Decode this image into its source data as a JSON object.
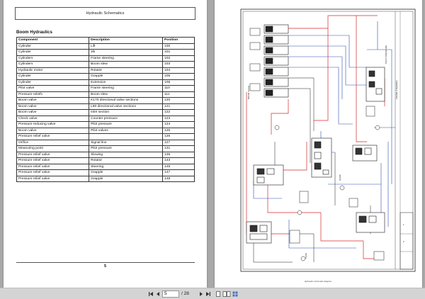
{
  "left_page": {
    "header": "Hydraulic Schematics",
    "section_title": "Boom Hydraulics",
    "table": {
      "headers": [
        "Component",
        "Description",
        "Position"
      ],
      "rows": [
        [
          "Cylinder",
          "Lift",
          "100"
        ],
        [
          "Cylinder",
          "Jib",
          "101"
        ],
        [
          "Cylinders",
          "Frame steering",
          "102"
        ],
        [
          "Cylinders",
          "Boom slew",
          "103"
        ],
        [
          "Hydraulic motor",
          "Rotator",
          "104"
        ],
        [
          "Cylinder",
          "Grapple",
          "105"
        ],
        [
          "Cylinder",
          "Extension",
          "106"
        ],
        [
          "Pilot valve",
          "Frame steering",
          "110"
        ],
        [
          "Pressure reliefs",
          "Boom slew",
          "111"
        ],
        [
          "Boom valve",
          "K170 directional valve sections",
          "120"
        ],
        [
          "Boom valve",
          "L90 directional valve sections",
          "121"
        ],
        [
          "Boom valve",
          "Inlet section",
          "122"
        ],
        [
          "Check valve",
          "Counter pressure",
          "123"
        ],
        [
          "Pressure reducing valve",
          "Pilot pressure",
          "124"
        ],
        [
          "Boom valve",
          "Pilot valves",
          "125"
        ],
        [
          "Pressure relief valve",
          "",
          "126"
        ],
        [
          "Orifice",
          "Signal line",
          "127"
        ],
        [
          "Measuring point",
          "Pilot pressure",
          "131"
        ],
        [
          "Pressure relief valve",
          "Slewing",
          "135"
        ],
        [
          "Pressure relief valve",
          "Rotator",
          "143"
        ],
        [
          "Pressure relief valve",
          "Steering",
          "145"
        ],
        [
          "Pressure relief valve",
          "Grapple",
          "147"
        ],
        [
          "Pressure relief valve",
          "Grapple",
          "148"
        ]
      ]
    },
    "page_number": "5"
  },
  "right_page": {
    "schematic_caption": "Hydraulic schematic diagram",
    "line_colors": {
      "pressure": "#d62b2b",
      "return": "#2d4fb0",
      "pilot": "#1a1a1a"
    }
  },
  "toolbar": {
    "first_icon": "first-page-icon",
    "prev_icon": "previous-page-icon",
    "current_page": "5",
    "total_pages": "/ 28",
    "next_icon": "next-page-icon",
    "last_icon": "last-page-icon",
    "view_icons": [
      "single-page-view-icon",
      "two-page-view-icon",
      "thumbnail-view-icon"
    ]
  }
}
